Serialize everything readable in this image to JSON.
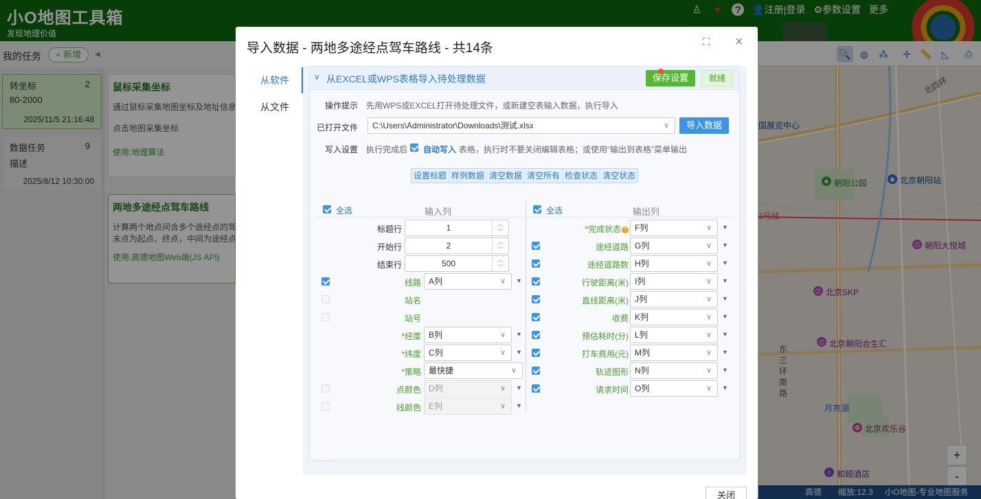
{
  "app": {
    "title": "小O地图工具箱",
    "slogan": "发现地理价值"
  },
  "topnav": {
    "register_login": "注册|登录",
    "settings": "参数设置",
    "more": "更多"
  },
  "tasks": {
    "header": "我的任务",
    "add_label": "+ 新增",
    "items": [
      {
        "name": "转坐标",
        "count": "2",
        "desc": "80-2000",
        "date": "2025/11/5 21:16:48",
        "active": true
      },
      {
        "name": "数据任务",
        "count": "9",
        "desc": "描述",
        "date": "2025/8/12 10:30:00",
        "active": false
      }
    ]
  },
  "feature_cards": [
    {
      "title": "鼠标采集坐标",
      "desc": "通过鼠标采集地图坐标及地址信息",
      "desc2": "点击地图采集坐标",
      "tag": "使用:地理算法"
    },
    {
      "title": "两地多途经点驾车路线",
      "desc": "计算两个地点间含多个途经点的驾",
      "desc2": "末点为起点、终点，中间为途经点",
      "tag": "使用:高德地图Web端(JS API)"
    }
  ],
  "map": {
    "labels": [
      "国展览中心",
      "朝阳公园",
      "北京朝阳站",
      "3号线",
      "朝阳大悦城",
      "北京SKP",
      "北京朝阳合生汇",
      "东三环南路",
      "月亮湖",
      "北京欢乐谷",
      "和颐酒店",
      "北四环"
    ],
    "status": {
      "provider": "高德",
      "zoom": "缩放:12.3",
      "brand": "小O地图-专业地图服务"
    },
    "zoom_in": "+",
    "zoom_out": "-"
  },
  "dialog": {
    "title": "导入数据 - 两地多途经点驾车路线 - 共14条",
    "nav": [
      {
        "label": "从软件",
        "active": true
      },
      {
        "label": "从文件",
        "active": false
      }
    ],
    "panel_title": "从EXCEL或WPS表格导入待处理数据",
    "save_label": "保存设置",
    "ready_label": "就绪",
    "hint_label": "操作提示",
    "hint_text": "先用WPS或EXCEL打开待处理文件，或新建空表输入数据，执行导入",
    "file_label": "已打开文件",
    "file_value": "C:\\Users\\Administrator\\Downloads\\测试.xlsx",
    "import_label": "导入数据",
    "write_label": "写入设置",
    "write_pre": "执行完成后",
    "auto_write": "自动写入",
    "write_post": "表格，执行时不要关闭编辑表格；或使用“输出到表格”菜单输出",
    "tools": [
      "设置标题",
      "样例数据",
      "清空数据",
      "清空所有",
      "检查状态",
      "清空状态"
    ],
    "select_all": "全选",
    "input_header": "输入列",
    "output_header": "输出列",
    "num_rows": [
      {
        "label": "标题行",
        "value": "1"
      },
      {
        "label": "开始行",
        "value": "2"
      },
      {
        "label": "结束行",
        "value": "500"
      }
    ],
    "input_rows": [
      {
        "label": "线路",
        "checked": true,
        "required": false,
        "value": "A列",
        "disabled": false,
        "arrow": true,
        "wide": false
      },
      {
        "label": "站名",
        "checked": false,
        "required": false,
        "value": "",
        "disabled": false,
        "arrow": false,
        "empty": true
      },
      {
        "label": "站号",
        "checked": false,
        "required": false,
        "value": "",
        "disabled": false,
        "arrow": false,
        "empty": true
      },
      {
        "label": "经度",
        "checked": null,
        "required": true,
        "value": "B列",
        "disabled": false,
        "arrow": true,
        "wide": false
      },
      {
        "label": "纬度",
        "checked": null,
        "required": true,
        "value": "C列",
        "disabled": false,
        "arrow": true,
        "wide": false
      },
      {
        "label": "策略",
        "checked": null,
        "required": true,
        "value": "最快捷",
        "disabled": false,
        "arrow": false,
        "wide": true
      },
      {
        "label": "点颜色",
        "checked": false,
        "required": false,
        "value": "D列",
        "disabled": true,
        "arrow": true,
        "wide": false
      },
      {
        "label": "线颜色",
        "checked": false,
        "required": false,
        "value": "E列",
        "disabled": true,
        "arrow": true,
        "wide": false
      }
    ],
    "output_rows": [
      {
        "label": "完成状态",
        "checked": null,
        "required": true,
        "help": true,
        "value": "F列"
      },
      {
        "label": "途经道路",
        "checked": true,
        "required": false,
        "value": "G列"
      },
      {
        "label": "途经道路数",
        "checked": true,
        "required": false,
        "value": "H列"
      },
      {
        "label": "行驶距离(米)",
        "checked": true,
        "required": false,
        "value": "I列"
      },
      {
        "label": "直线距离(米)",
        "checked": true,
        "required": false,
        "value": "J列"
      },
      {
        "label": "收费",
        "checked": true,
        "required": false,
        "value": "K列"
      },
      {
        "label": "预估耗时(分)",
        "checked": true,
        "required": false,
        "value": "L列"
      },
      {
        "label": "打车费用(元)",
        "checked": true,
        "required": false,
        "value": "M列"
      },
      {
        "label": "轨迹图形",
        "checked": true,
        "required": false,
        "value": "N列"
      },
      {
        "label": "请求时间",
        "checked": true,
        "required": false,
        "value": "O列"
      }
    ],
    "close_label": "关闭"
  }
}
